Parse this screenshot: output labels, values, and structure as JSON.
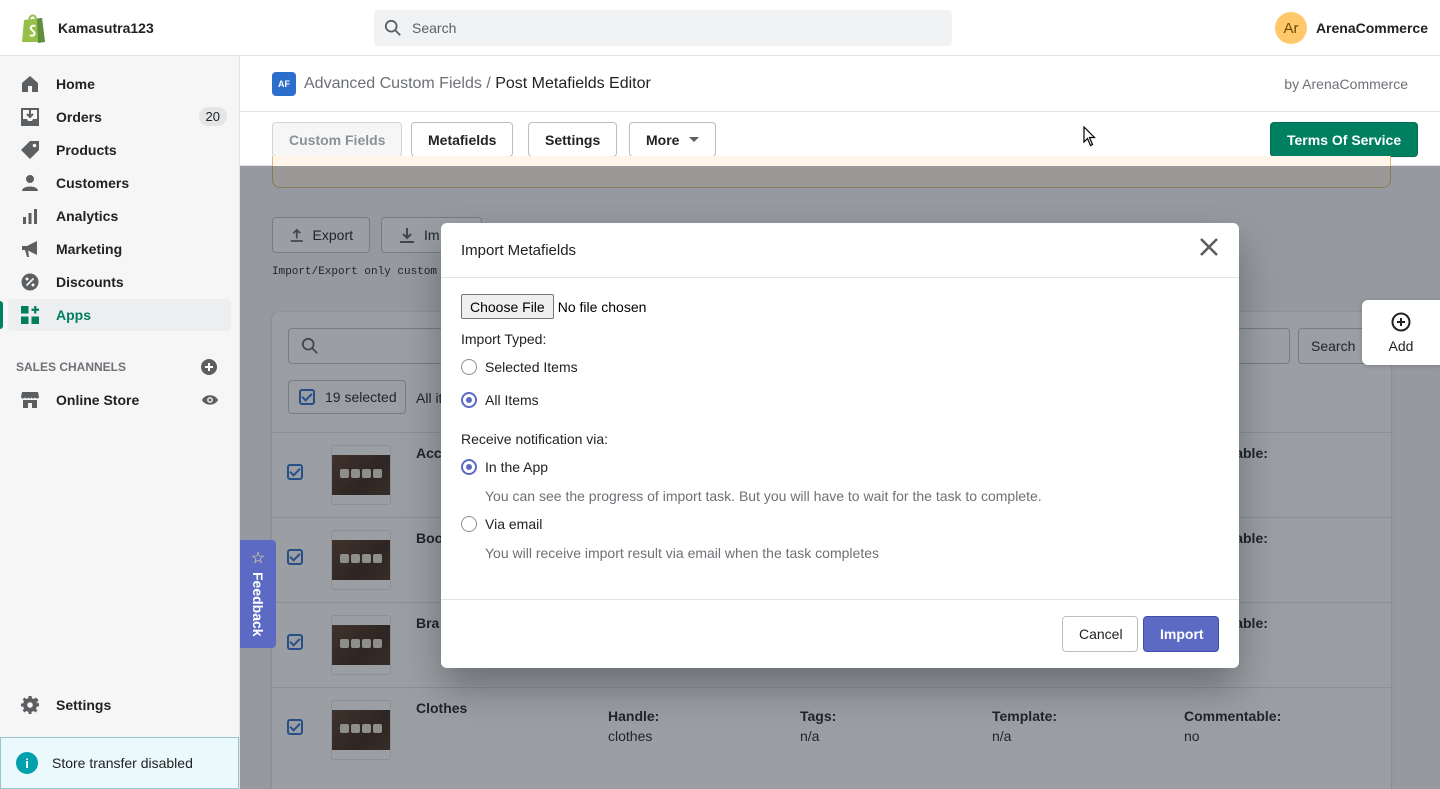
{
  "topbar": {
    "store_name": "Kamasutra123",
    "search_placeholder": "Search",
    "user_initials": "Ar",
    "user_name": "ArenaCommerce"
  },
  "sidebar": {
    "items": [
      {
        "label": "Home",
        "icon": "home-icon"
      },
      {
        "label": "Orders",
        "icon": "orders-icon",
        "badge": "20"
      },
      {
        "label": "Products",
        "icon": "tag-icon"
      },
      {
        "label": "Customers",
        "icon": "person-icon"
      },
      {
        "label": "Analytics",
        "icon": "bar-chart-icon"
      },
      {
        "label": "Marketing",
        "icon": "megaphone-icon"
      },
      {
        "label": "Discounts",
        "icon": "discount-icon"
      },
      {
        "label": "Apps",
        "icon": "apps-icon",
        "active": true
      }
    ],
    "sales_channels_title": "SALES CHANNELS",
    "online_store": "Online Store",
    "settings": "Settings",
    "store_transfer": "Store transfer disabled"
  },
  "app": {
    "breadcrumb_parent": "Advanced Custom Fields",
    "breadcrumb_sep": "/",
    "breadcrumb_current": "Post Metafields Editor",
    "byline": "by ArenaCommerce",
    "logo_text": "AF",
    "toolbar": {
      "custom_fields": "Custom Fields",
      "metafields": "Metafields",
      "settings": "Settings",
      "more": "More",
      "terms": "Terms Of Service"
    }
  },
  "content": {
    "export_label": "Export",
    "import_label": "Im",
    "note": "Import/Export only custom f",
    "search_button": "Search",
    "selected_count": "19 selected",
    "select_all": "All it",
    "add_label": "Add",
    "feedback": "Feedback",
    "rows": [
      {
        "title": "Acc",
        "commentable_label": "ntable:"
      },
      {
        "title": "Boo",
        "commentable_label": "ntable:"
      },
      {
        "title": "Bra",
        "commentable_label": "ntable:"
      },
      {
        "title": "Clothes",
        "handle_label": "Handle:",
        "handle": "clothes",
        "tags_label": "Tags:",
        "tags": "n/a",
        "template_label": "Template:",
        "template": "n/a",
        "commentable_label": "Commentable:",
        "commentable": "no"
      }
    ]
  },
  "modal": {
    "title": "Import Metafields",
    "choose_file": "Choose File",
    "no_file": "No file chosen",
    "import_typed_label": "Import Typed:",
    "option_selected": "Selected Items",
    "option_all": "All Items",
    "notify_label": "Receive notification via:",
    "option_app": "In the App",
    "app_help": "You can see the progress of import task. But you will have to wait for the task to complete.",
    "option_email": "Via email",
    "email_help": "You will receive import result via email when the task completes",
    "cancel": "Cancel",
    "import": "Import"
  },
  "colors": {
    "brand_green": "#008060",
    "primary_indigo": "#5c6ac4",
    "overlay": "#212b36"
  }
}
